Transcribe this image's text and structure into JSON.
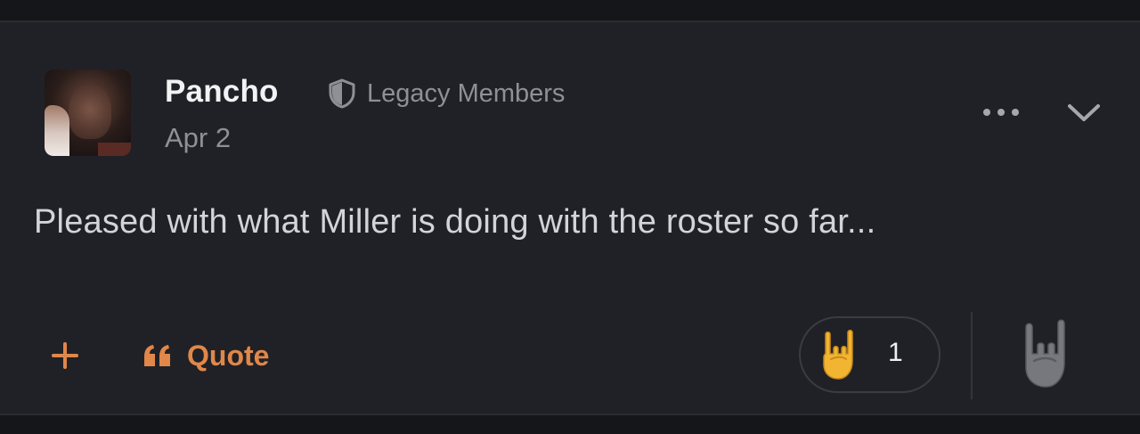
{
  "post": {
    "author": "Pancho",
    "date": "Apr 2",
    "badge": {
      "label": "Legacy Members",
      "icon": "shield-icon"
    },
    "content": "Pleased with what Miller is doing with the roster so far...",
    "menu_icons": {
      "more": "more-icon",
      "collapse": "chevron-down-icon"
    }
  },
  "actions": {
    "add_icon": "plus-icon",
    "quote_label": "Quote",
    "quote_icon": "quote-icon"
  },
  "reactions": {
    "items": [
      {
        "emoji": "sign-of-the-horns",
        "count": "1"
      }
    ],
    "add_reaction_icon": "sign-of-the-horns-icon"
  },
  "colors": {
    "background": "#202126",
    "accent": "#e0874a",
    "text": "#d3d4d8",
    "muted": "#8f9097"
  }
}
